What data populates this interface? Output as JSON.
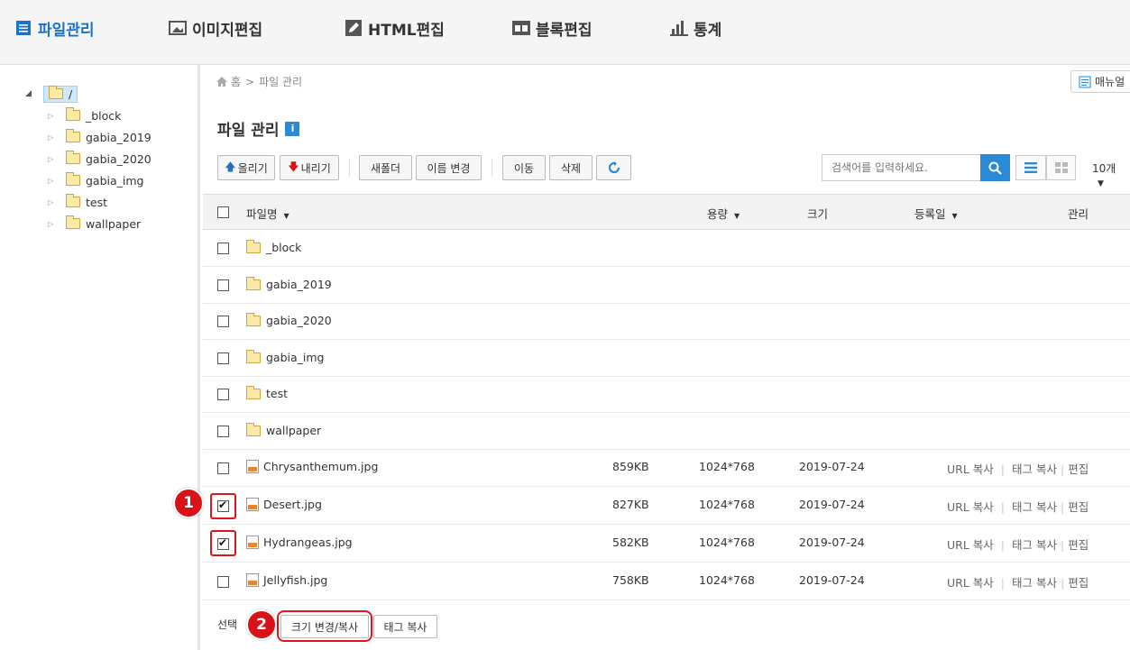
{
  "nav": {
    "items": [
      {
        "label": "파일관리",
        "icon": "list-icon"
      },
      {
        "label": "이미지편집",
        "icon": "image-icon"
      },
      {
        "label": "HTML편집",
        "icon": "pencil-icon"
      },
      {
        "label": "블록편집",
        "icon": "block-icon"
      },
      {
        "label": "통계",
        "icon": "bar-chart-icon"
      }
    ],
    "active_color": "#1a73c8"
  },
  "tree": {
    "root": "/",
    "children": [
      "_block",
      "gabia_2019",
      "gabia_2020",
      "gabia_img",
      "test",
      "wallpaper"
    ]
  },
  "breadcrumb": {
    "home": "홈",
    "sep": ">",
    "current": "파일 관리"
  },
  "manual_label": "매뉴얼",
  "page_title": "파일 관리",
  "info_label": "i",
  "toolbar": {
    "up": "올리기",
    "down": "내리기",
    "new_folder": "새폴더",
    "rename": "이름 변경",
    "move": "이동",
    "delete": "삭제"
  },
  "search": {
    "placeholder": "검색어를 입력하세요."
  },
  "per_page": "10개",
  "columns": {
    "name": "파일명",
    "capacity": "용량",
    "size": "크기",
    "date": "등록일",
    "manage": "관리"
  },
  "folders": [
    "_block",
    "gabia_2019",
    "gabia_2020",
    "gabia_img",
    "test",
    "wallpaper"
  ],
  "files": [
    {
      "name": "Chrysanthemum.jpg",
      "capacity": "859KB",
      "size": "1024*768",
      "date": "2019-07-24",
      "checked": false
    },
    {
      "name": "Desert.jpg",
      "capacity": "827KB",
      "size": "1024*768",
      "date": "2019-07-24",
      "checked": true
    },
    {
      "name": "Hydrangeas.jpg",
      "capacity": "582KB",
      "size": "1024*768",
      "date": "2019-07-24",
      "checked": true
    },
    {
      "name": "Jellyfish.jpg",
      "capacity": "758KB",
      "size": "1024*768",
      "date": "2019-07-24",
      "checked": false
    }
  ],
  "actions": {
    "url_copy": "URL 복사",
    "tag_copy": "태그 복사",
    "edit": "편집"
  },
  "bottom": {
    "label": "선택",
    "resize_copy": "크기 변경/복사",
    "tag_copy": "태그 복사"
  },
  "annotations": [
    "1",
    "2"
  ],
  "highlight_color": "#e0141c"
}
